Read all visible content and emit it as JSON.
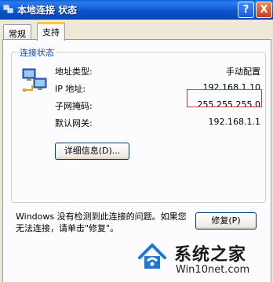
{
  "window": {
    "title": "本地连接 状态",
    "help_button": "?",
    "close_button": "X"
  },
  "tabs": [
    {
      "label": "常规",
      "selected": false
    },
    {
      "label": "支持",
      "selected": true
    }
  ],
  "status_group": {
    "label": "连接状态",
    "rows": [
      {
        "key": "地址类型:",
        "value": "手动配置"
      },
      {
        "key": "IP 地址:",
        "value": "192.168.1.10"
      },
      {
        "key": "子网掩码:",
        "value": "255.255.255.0"
      },
      {
        "key": "默认网关:",
        "value": "192.168.1.1"
      }
    ],
    "details_button": "详细信息(D)..."
  },
  "message": "Windows 没有检测到此连接的问题。如果您无法连接，请单击\"修复\"。",
  "repair_button": "修复(P)",
  "watermark": {
    "name": "系统之家",
    "url": "Win10net.com"
  },
  "colors": {
    "titlebar": "#0A52C9",
    "group_label": "#0046D5",
    "highlight_box": "#E03030"
  }
}
